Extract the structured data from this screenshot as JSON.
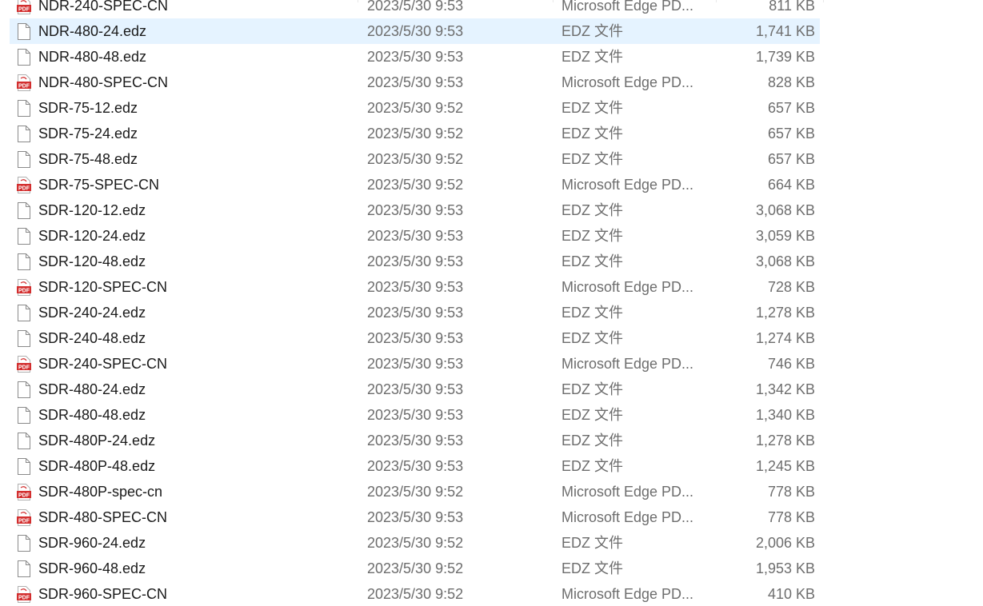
{
  "files": [
    {
      "name": "NDR-240-SPEC-CN",
      "date": "2023/5/30 9:53",
      "type": "Microsoft Edge PD...",
      "size": "811 KB",
      "icon": "pdf-icon",
      "selected": false
    },
    {
      "name": "NDR-480-24.edz",
      "date": "2023/5/30 9:53",
      "type": "EDZ 文件",
      "size": "1,741 KB",
      "icon": "file-icon",
      "selected": true
    },
    {
      "name": "NDR-480-48.edz",
      "date": "2023/5/30 9:53",
      "type": "EDZ 文件",
      "size": "1,739 KB",
      "icon": "file-icon",
      "selected": false
    },
    {
      "name": "NDR-480-SPEC-CN",
      "date": "2023/5/30 9:53",
      "type": "Microsoft Edge PD...",
      "size": "828 KB",
      "icon": "pdf-icon",
      "selected": false
    },
    {
      "name": "SDR-75-12.edz",
      "date": "2023/5/30 9:52",
      "type": "EDZ 文件",
      "size": "657 KB",
      "icon": "file-icon",
      "selected": false
    },
    {
      "name": "SDR-75-24.edz",
      "date": "2023/5/30 9:52",
      "type": "EDZ 文件",
      "size": "657 KB",
      "icon": "file-icon",
      "selected": false
    },
    {
      "name": "SDR-75-48.edz",
      "date": "2023/5/30 9:52",
      "type": "EDZ 文件",
      "size": "657 KB",
      "icon": "file-icon",
      "selected": false
    },
    {
      "name": "SDR-75-SPEC-CN",
      "date": "2023/5/30 9:52",
      "type": "Microsoft Edge PD...",
      "size": "664 KB",
      "icon": "pdf-icon",
      "selected": false
    },
    {
      "name": "SDR-120-12.edz",
      "date": "2023/5/30 9:53",
      "type": "EDZ 文件",
      "size": "3,068 KB",
      "icon": "file-icon",
      "selected": false
    },
    {
      "name": "SDR-120-24.edz",
      "date": "2023/5/30 9:53",
      "type": "EDZ 文件",
      "size": "3,059 KB",
      "icon": "file-icon",
      "selected": false
    },
    {
      "name": "SDR-120-48.edz",
      "date": "2023/5/30 9:53",
      "type": "EDZ 文件",
      "size": "3,068 KB",
      "icon": "file-icon",
      "selected": false
    },
    {
      "name": "SDR-120-SPEC-CN",
      "date": "2023/5/30 9:53",
      "type": "Microsoft Edge PD...",
      "size": "728 KB",
      "icon": "pdf-icon",
      "selected": false
    },
    {
      "name": "SDR-240-24.edz",
      "date": "2023/5/30 9:53",
      "type": "EDZ 文件",
      "size": "1,278 KB",
      "icon": "file-icon",
      "selected": false
    },
    {
      "name": "SDR-240-48.edz",
      "date": "2023/5/30 9:53",
      "type": "EDZ 文件",
      "size": "1,274 KB",
      "icon": "file-icon",
      "selected": false
    },
    {
      "name": "SDR-240-SPEC-CN",
      "date": "2023/5/30 9:53",
      "type": "Microsoft Edge PD...",
      "size": "746 KB",
      "icon": "pdf-icon",
      "selected": false
    },
    {
      "name": "SDR-480-24.edz",
      "date": "2023/5/30 9:53",
      "type": "EDZ 文件",
      "size": "1,342 KB",
      "icon": "file-icon",
      "selected": false
    },
    {
      "name": "SDR-480-48.edz",
      "date": "2023/5/30 9:53",
      "type": "EDZ 文件",
      "size": "1,340 KB",
      "icon": "file-icon",
      "selected": false
    },
    {
      "name": "SDR-480P-24.edz",
      "date": "2023/5/30 9:53",
      "type": "EDZ 文件",
      "size": "1,278 KB",
      "icon": "file-icon",
      "selected": false
    },
    {
      "name": "SDR-480P-48.edz",
      "date": "2023/5/30 9:53",
      "type": "EDZ 文件",
      "size": "1,245 KB",
      "icon": "file-icon",
      "selected": false
    },
    {
      "name": "SDR-480P-spec-cn",
      "date": "2023/5/30 9:52",
      "type": "Microsoft Edge PD...",
      "size": "778 KB",
      "icon": "pdf-icon",
      "selected": false
    },
    {
      "name": "SDR-480-SPEC-CN",
      "date": "2023/5/30 9:53",
      "type": "Microsoft Edge PD...",
      "size": "778 KB",
      "icon": "pdf-icon",
      "selected": false
    },
    {
      "name": "SDR-960-24.edz",
      "date": "2023/5/30 9:52",
      "type": "EDZ 文件",
      "size": "2,006 KB",
      "icon": "file-icon",
      "selected": false
    },
    {
      "name": "SDR-960-48.edz",
      "date": "2023/5/30 9:52",
      "type": "EDZ 文件",
      "size": "1,953 KB",
      "icon": "file-icon",
      "selected": false
    },
    {
      "name": "SDR-960-SPEC-CN",
      "date": "2023/5/30 9:52",
      "type": "Microsoft Edge PD...",
      "size": "410 KB",
      "icon": "pdf-icon",
      "selected": false
    }
  ],
  "pdf_badge_text": "PDF",
  "colors": {
    "selection": "#e5f3ff",
    "pdf_red": "#d32f2f",
    "name_text": "#1a1a1a",
    "meta_text": "#6d6d6d"
  }
}
